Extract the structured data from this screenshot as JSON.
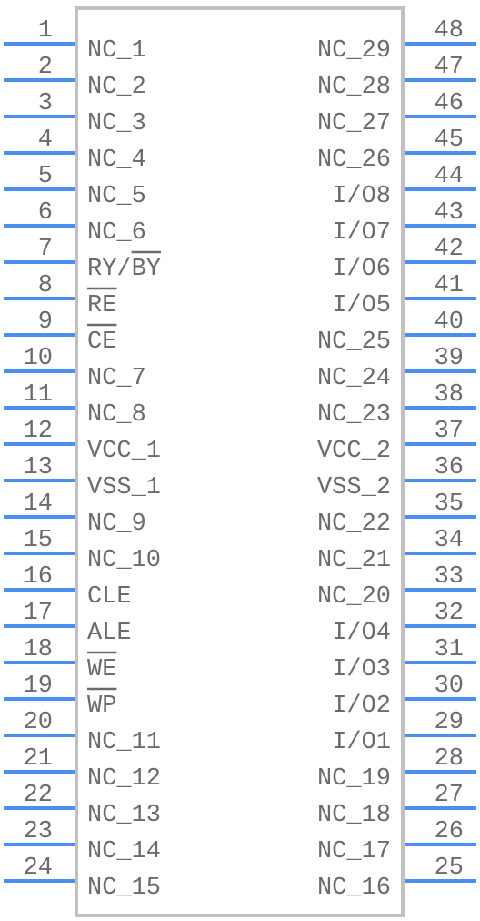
{
  "component": {
    "left_pins": [
      {
        "num": "1",
        "name": "NC_1"
      },
      {
        "num": "2",
        "name": "NC_2"
      },
      {
        "num": "3",
        "name": "NC_3"
      },
      {
        "num": "4",
        "name": "NC_4"
      },
      {
        "num": "5",
        "name": "NC_5"
      },
      {
        "num": "6",
        "name": "NC_6"
      },
      {
        "num": "7",
        "name": "RY/BY",
        "overbar": "BY"
      },
      {
        "num": "8",
        "name": "RE",
        "overbar": "RE"
      },
      {
        "num": "9",
        "name": "CE",
        "overbar": "CE"
      },
      {
        "num": "10",
        "name": "NC_7"
      },
      {
        "num": "11",
        "name": "NC_8"
      },
      {
        "num": "12",
        "name": "VCC_1"
      },
      {
        "num": "13",
        "name": "VSS_1"
      },
      {
        "num": "14",
        "name": "NC_9"
      },
      {
        "num": "15",
        "name": "NC_10"
      },
      {
        "num": "16",
        "name": "CLE"
      },
      {
        "num": "17",
        "name": "ALE"
      },
      {
        "num": "18",
        "name": "WE",
        "overbar": "WE"
      },
      {
        "num": "19",
        "name": "WP",
        "overbar": "WP"
      },
      {
        "num": "20",
        "name": "NC_11"
      },
      {
        "num": "21",
        "name": "NC_12"
      },
      {
        "num": "22",
        "name": "NC_13"
      },
      {
        "num": "23",
        "name": "NC_14"
      },
      {
        "num": "24",
        "name": "NC_15"
      }
    ],
    "right_pins": [
      {
        "num": "48",
        "name": "NC_29"
      },
      {
        "num": "47",
        "name": "NC_28"
      },
      {
        "num": "46",
        "name": "NC_27"
      },
      {
        "num": "45",
        "name": "NC_26"
      },
      {
        "num": "44",
        "name": "I/O8"
      },
      {
        "num": "43",
        "name": "I/O7"
      },
      {
        "num": "42",
        "name": "I/O6"
      },
      {
        "num": "41",
        "name": "I/O5"
      },
      {
        "num": "40",
        "name": "NC_25"
      },
      {
        "num": "39",
        "name": "NC_24"
      },
      {
        "num": "38",
        "name": "NC_23"
      },
      {
        "num": "37",
        "name": "VCC_2"
      },
      {
        "num": "36",
        "name": "VSS_2"
      },
      {
        "num": "35",
        "name": "NC_22"
      },
      {
        "num": "34",
        "name": "NC_21"
      },
      {
        "num": "33",
        "name": "NC_20"
      },
      {
        "num": "32",
        "name": "I/O4"
      },
      {
        "num": "31",
        "name": "I/O3"
      },
      {
        "num": "30",
        "name": "I/O2"
      },
      {
        "num": "29",
        "name": "I/O1"
      },
      {
        "num": "28",
        "name": "NC_19"
      },
      {
        "num": "27",
        "name": "NC_18"
      },
      {
        "num": "26",
        "name": "NC_17"
      },
      {
        "num": "25",
        "name": "NC_16"
      }
    ],
    "colors": {
      "pin": "#4a8ef0",
      "outline": "#c0c0c0",
      "text": "#6b6b6b"
    }
  }
}
